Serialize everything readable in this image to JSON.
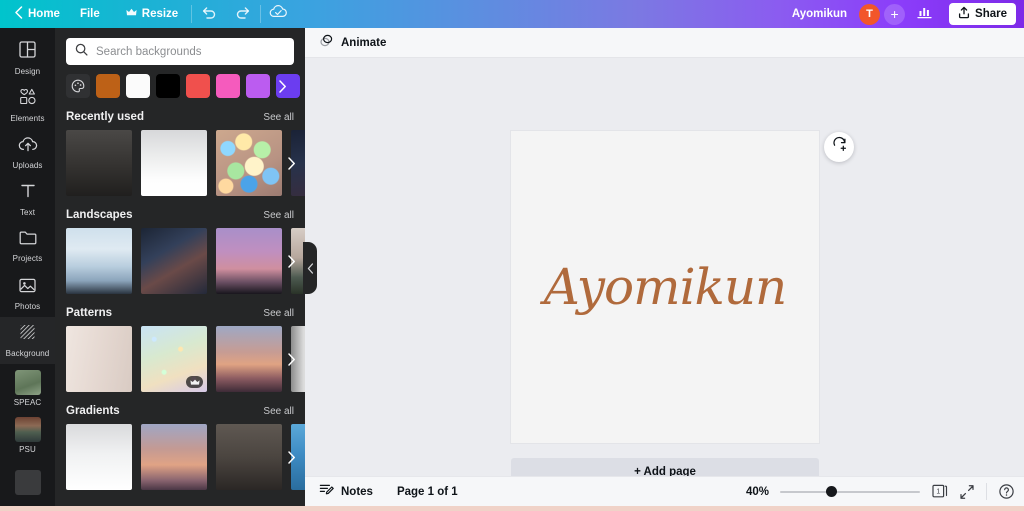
{
  "topbar": {
    "back_icon": "chevron-left-icon",
    "home_label": "Home",
    "file_label": "File",
    "resize_label": "Resize",
    "resize_icon": "crown-icon",
    "undo_icon": "undo-icon",
    "redo_icon": "redo-icon",
    "cloud_icon": "cloud-saved-icon",
    "doc_title": "Ayomikun",
    "avatar_initial": "T",
    "add_collaborator_label": "+",
    "insights_icon": "bar-chart-icon",
    "share_icon": "share-upload-icon",
    "share_label": "Share",
    "accent_start": "#00c4cc",
    "accent_end": "#7d2ae8"
  },
  "rail": {
    "items": [
      {
        "label": "Design",
        "icon": "design-grid-icon",
        "active": false,
        "type": "icon"
      },
      {
        "label": "Elements",
        "icon": "elements-shapes-icon",
        "active": false,
        "type": "icon"
      },
      {
        "label": "Uploads",
        "icon": "upload-cloud-icon",
        "active": false,
        "type": "icon"
      },
      {
        "label": "Text",
        "icon": "text-t-icon",
        "active": false,
        "type": "icon"
      },
      {
        "label": "Projects",
        "icon": "folder-icon",
        "active": false,
        "type": "icon"
      },
      {
        "label": "Photos",
        "icon": "photo-icon",
        "active": false,
        "type": "icon"
      },
      {
        "label": "Background",
        "icon": "background-hatch-icon",
        "active": true,
        "type": "icon"
      },
      {
        "label": "SPEAC",
        "icon": "app-thumb-speac",
        "active": false,
        "type": "thumb"
      },
      {
        "label": "PSU",
        "icon": "app-thumb-psu",
        "active": false,
        "type": "thumb"
      }
    ]
  },
  "panel": {
    "search": {
      "icon": "search-icon",
      "placeholder": "Search backgrounds",
      "value": ""
    },
    "color_picker_icon": "color-palette-icon",
    "swatch_next_icon": "chevron-right-icon",
    "swatches": [
      {
        "name": "swatch-orange",
        "color": "#bd6117"
      },
      {
        "name": "swatch-white",
        "color": "#fbfbfb"
      },
      {
        "name": "swatch-black",
        "color": "#000000"
      },
      {
        "name": "swatch-red",
        "color": "#f0504d"
      },
      {
        "name": "swatch-pink",
        "color": "#f55bbd"
      },
      {
        "name": "swatch-violet",
        "color": "#bb5cf0"
      },
      {
        "name": "swatch-purple",
        "color": "#6b3df0"
      }
    ],
    "see_all_label": "See all",
    "row_next_icon": "chevron-right-icon",
    "sections": [
      {
        "title": "Recently used",
        "tiles": [
          {
            "name": "tile-dark-gradient",
            "art": "t-dkgrad",
            "premium": false
          },
          {
            "name": "tile-white-gradient",
            "art": "t-whgrad",
            "premium": false
          },
          {
            "name": "tile-bokeh-lights",
            "art": "t-bokeh",
            "premium": false
          },
          {
            "name": "tile-night-scene",
            "art": "t-night",
            "premium": false
          }
        ]
      },
      {
        "title": "Landscapes",
        "tiles": [
          {
            "name": "tile-misty-mountains",
            "art": "t-mtn",
            "premium": false
          },
          {
            "name": "tile-city-aerial",
            "art": "t-city",
            "premium": false
          },
          {
            "name": "tile-purple-dusk",
            "art": "t-dusk",
            "premium": false
          },
          {
            "name": "tile-landscape-edge",
            "art": "t-edge1",
            "premium": false
          }
        ]
      },
      {
        "title": "Patterns",
        "tiles": [
          {
            "name": "tile-white-wood",
            "art": "t-wood",
            "premium": false
          },
          {
            "name": "tile-glitter",
            "art": "t-glitter",
            "premium": true
          },
          {
            "name": "tile-sunset-blur",
            "art": "t-sunset",
            "premium": false
          },
          {
            "name": "tile-brushed-metal",
            "art": "t-metal",
            "premium": false
          }
        ]
      },
      {
        "title": "Gradients",
        "tiles": [
          {
            "name": "tile-white-fade",
            "art": "t-white",
            "premium": false
          },
          {
            "name": "tile-peach-blur",
            "art": "t-peach",
            "premium": false
          },
          {
            "name": "tile-brown-fade",
            "art": "t-brown",
            "premium": false
          },
          {
            "name": "tile-blue-fade",
            "art": "t-blue",
            "premium": false
          }
        ]
      }
    ],
    "collapse_icon": "chevron-left-icon"
  },
  "editor": {
    "animate_icon": "animate-circles-icon",
    "animate_label": "Animate",
    "page_tools": [
      {
        "name": "lock-page-icon",
        "icon": "lock-icon"
      },
      {
        "name": "duplicate-page-icon",
        "icon": "duplicate-icon"
      },
      {
        "name": "add-page-icon",
        "icon": "add-page-icon"
      }
    ],
    "magic_button_icon": "magic-refresh-icon",
    "page_text": "Ayomikun",
    "page_text_color": "#b06a3c",
    "page_background": "#f4f4f4",
    "add_page_label": "+ Add page",
    "timeline_toggle_icon": "chevron-up-icon"
  },
  "bottombar": {
    "notes_icon": "notes-icon",
    "notes_label": "Notes",
    "page_count_label": "Page 1 of 1",
    "zoom_label": "40%",
    "zoom_value": 40,
    "page_manager_icon": "page-manager-icon",
    "page_manager_badge": "1",
    "fullscreen_icon": "fullscreen-expand-icon",
    "help_icon": "help-question-icon"
  }
}
